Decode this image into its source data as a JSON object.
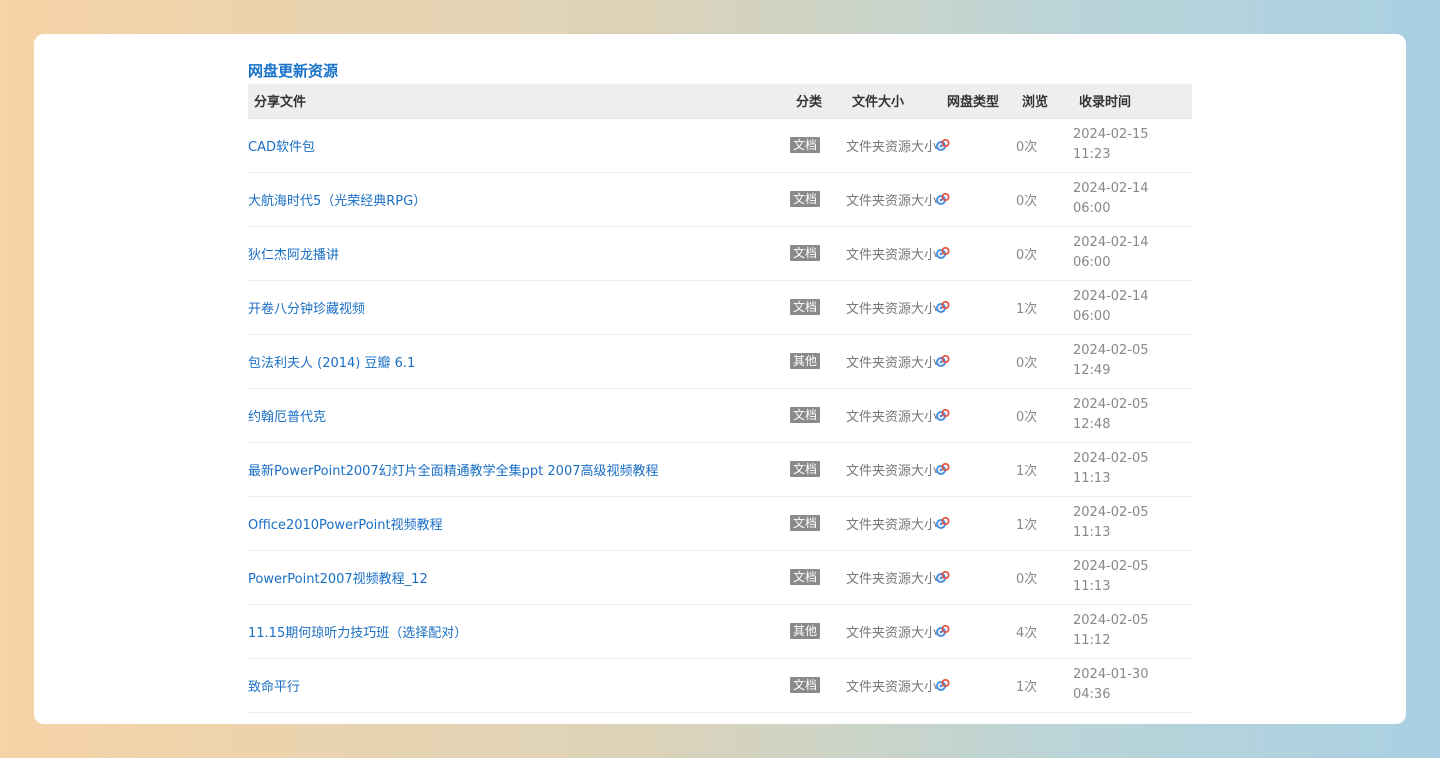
{
  "section": {
    "title": "网盘更新资源"
  },
  "table": {
    "headers": {
      "file": "分享文件",
      "category": "分类",
      "size": "文件大小",
      "disk_type": "网盘类型",
      "views": "浏览",
      "time": "收录时间"
    },
    "disk_icon": "baidu-pan-icon",
    "rows": [
      {
        "file": "CAD软件包",
        "category": "文档",
        "size": "文件夹资源大小",
        "views": "0次",
        "date": "2024-02-15",
        "clock": "11:23"
      },
      {
        "file": "大航海时代5（光荣经典RPG）",
        "category": "文档",
        "size": "文件夹资源大小",
        "views": "0次",
        "date": "2024-02-14",
        "clock": "06:00"
      },
      {
        "file": "狄仁杰阿龙播讲",
        "category": "文档",
        "size": "文件夹资源大小",
        "views": "0次",
        "date": "2024-02-14",
        "clock": "06:00"
      },
      {
        "file": "开卷八分钟珍藏视频",
        "category": "文档",
        "size": "文件夹资源大小",
        "views": "1次",
        "date": "2024-02-14",
        "clock": "06:00"
      },
      {
        "file": "包法利夫人 (2014) 豆瓣 6.1",
        "category": "其他",
        "size": "文件夹资源大小",
        "views": "0次",
        "date": "2024-02-05",
        "clock": "12:49"
      },
      {
        "file": "约翰厄普代克",
        "category": "文档",
        "size": "文件夹资源大小",
        "views": "0次",
        "date": "2024-02-05",
        "clock": "12:48"
      },
      {
        "file": "最新PowerPoint2007幻灯片全面精通教学全集ppt 2007高级视频教程",
        "category": "文档",
        "size": "文件夹资源大小",
        "views": "1次",
        "date": "2024-02-05",
        "clock": "11:13"
      },
      {
        "file": "Office2010PowerPoint视频教程",
        "category": "文档",
        "size": "文件夹资源大小",
        "views": "1次",
        "date": "2024-02-05",
        "clock": "11:13"
      },
      {
        "file": "PowerPoint2007视频教程_12",
        "category": "文档",
        "size": "文件夹资源大小",
        "views": "0次",
        "date": "2024-02-05",
        "clock": "11:13"
      },
      {
        "file": "11.15期何琼听力技巧班（选择配对）",
        "category": "其他",
        "size": "文件夹资源大小",
        "views": "4次",
        "date": "2024-02-05",
        "clock": "11:12"
      },
      {
        "file": "致命平行",
        "category": "文档",
        "size": "文件夹资源大小",
        "views": "1次",
        "date": "2024-01-30",
        "clock": "04:36"
      }
    ]
  }
}
